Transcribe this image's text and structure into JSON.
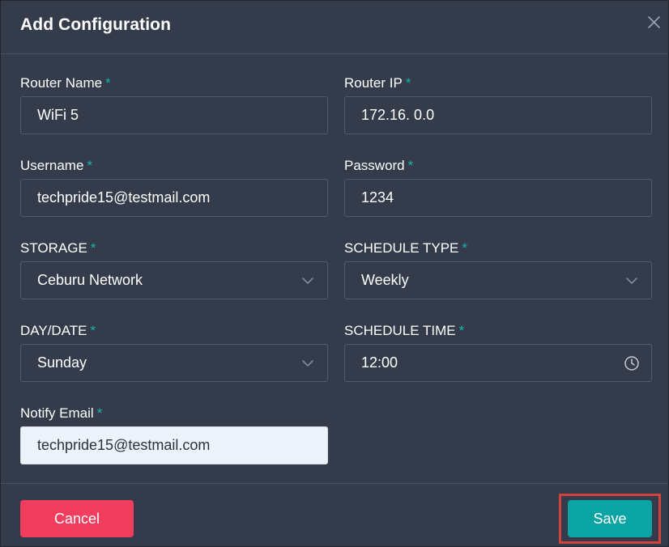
{
  "dialog": {
    "title": "Add Configuration",
    "required_mark": "*"
  },
  "fields": {
    "router_name": {
      "label": "Router Name",
      "value": "WiFi 5"
    },
    "router_ip": {
      "label": "Router IP",
      "value": "172.16. 0.0"
    },
    "username": {
      "label": "Username",
      "value": "techpride15@testmail.com"
    },
    "password": {
      "label": "Password",
      "value": "1234"
    },
    "storage": {
      "label": "STORAGE",
      "value": "Ceburu Network"
    },
    "schedule_type": {
      "label": "SCHEDULE TYPE",
      "value": "Weekly"
    },
    "day_date": {
      "label": "DAY/DATE",
      "value": "Sunday"
    },
    "schedule_time": {
      "label": "SCHEDULE TIME",
      "value": "12:00"
    },
    "notify_email": {
      "label": "Notify Email",
      "value": "techpride15@testmail.com"
    }
  },
  "footer": {
    "cancel_label": "Cancel",
    "save_label": "Save"
  },
  "icons": {
    "close": "close-icon",
    "dropdown": "chevron-down-icon",
    "time": "clock-icon"
  },
  "colors": {
    "background": "#343b4a",
    "required": "#17b3ae",
    "cancel": "#f23e5e",
    "save": "#0ba4a4",
    "highlight": "#d0443c"
  }
}
